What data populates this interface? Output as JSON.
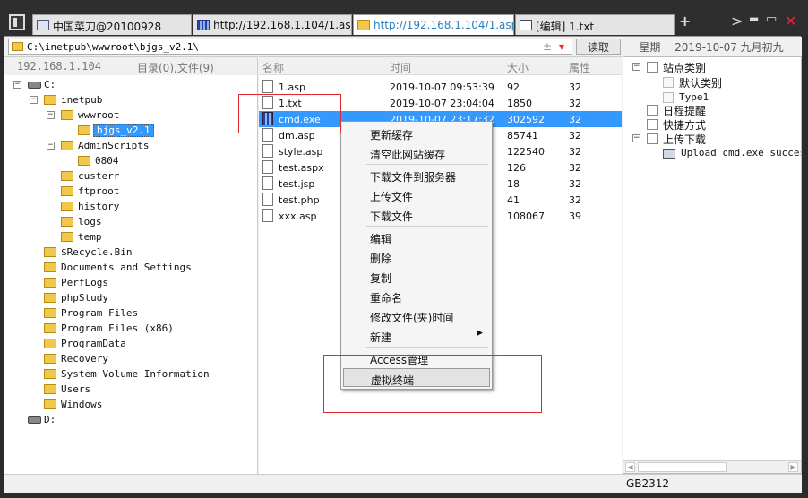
{
  "tabs": [
    {
      "label": "中国菜刀@20100928",
      "icon": "page-icon"
    },
    {
      "label": "http://192.168.1.104/1.asp",
      "icon": "grid-icon"
    },
    {
      "label": "http://192.168.1.104/1.asp",
      "icon": "folder-icon",
      "active": true
    },
    {
      "label": "[编辑] 1.txt",
      "icon": "doc-icon"
    }
  ],
  "window_controls": {
    "add": "+",
    "next": ">",
    "minimize": "▬",
    "maximize": "▭",
    "close": "✕"
  },
  "pathbar": {
    "path": "C:\\inetpub\\wwwroot\\bjgs_v2.1\\",
    "pm": "±",
    "dropdown": "▾",
    "read_label": "读取",
    "date": "星期一 2019-10-07 九月初九"
  },
  "left_header": {
    "ip": "192.168.1.104",
    "counts": "目录(0),文件(9)"
  },
  "tree": {
    "c_drive": "C:",
    "inetpub": "inetpub",
    "wwwroot": "wwwroot",
    "bjgs": "bjgs_v2.1",
    "adminscripts": "AdminScripts",
    "f0804": "0804",
    "custerr": "custerr",
    "ftproot": "ftproot",
    "history": "history",
    "logs": "logs",
    "temp": "temp",
    "recycle": "$Recycle.Bin",
    "docs": "Documents and Settings",
    "perflogs": "PerfLogs",
    "phpstudy": "phpStudy",
    "progfiles": "Program Files",
    "progfiles86": "Program Files (x86)",
    "progdata": "ProgramData",
    "recovery": "Recovery",
    "svi": "System Volume Information",
    "users": "Users",
    "windows": "Windows",
    "d_drive": "D:",
    "expand_minus": "−",
    "expand_plus": "+"
  },
  "file_columns": {
    "name": "名称",
    "time": "时间",
    "size": "大小",
    "attr": "属性"
  },
  "files": [
    {
      "name": "1.asp",
      "time": "2019-10-07 09:53:39",
      "size": "92",
      "attr": "32"
    },
    {
      "name": "1.txt",
      "time": "2019-10-07 23:04:04",
      "size": "1850",
      "attr": "32"
    },
    {
      "name": "cmd.exe",
      "time": "2019-10-07 23:17:32",
      "size": "302592",
      "attr": "32"
    },
    {
      "name": "dm.asp",
      "time": "",
      "size": "85741",
      "attr": "32"
    },
    {
      "name": "style.asp",
      "time": "",
      "size": "122540",
      "attr": "32"
    },
    {
      "name": "test.aspx",
      "time": "",
      "size": "126",
      "attr": "32"
    },
    {
      "name": "test.jsp",
      "time": "",
      "size": "18",
      "attr": "32"
    },
    {
      "name": "test.php",
      "time": "",
      "size": "41",
      "attr": "32"
    },
    {
      "name": "xxx.asp",
      "time": "",
      "size": "108067",
      "attr": "39"
    }
  ],
  "right_tree": {
    "site_category": "站点类别",
    "default_category": "默认类别",
    "type1": "Type1",
    "schedule": "日程提醒",
    "shortcuts": "快捷方式",
    "upload_download": "上传下载",
    "upload_log": "Upload cmd.exe success,"
  },
  "context_menu": {
    "refresh_cache": "更新缓存",
    "clear_cache": "清空此网站缓存",
    "download_to_server": "下载文件到服务器",
    "upload_file": "上传文件",
    "download_file": "下载文件",
    "edit": "编辑",
    "delete": "删除",
    "copy": "复制",
    "rename": "重命名",
    "modify_time": "修改文件(夹)时间",
    "new": "新建",
    "submenu_arrow": "▶",
    "access": "Access管理",
    "virtual_terminal": "虚拟终端"
  },
  "status": {
    "encoding": "GB2312"
  },
  "colors": {
    "selection": "#3399ff",
    "annotation": "#e0282e",
    "folder": "#f2c84b"
  }
}
